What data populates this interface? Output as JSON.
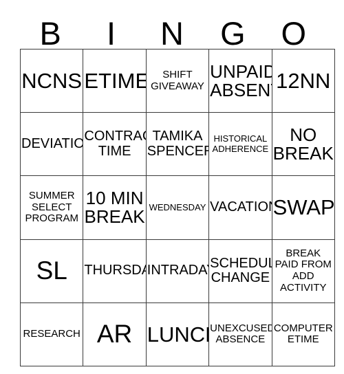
{
  "card": {
    "header_letters": [
      "B",
      "I",
      "N",
      "G",
      "O"
    ],
    "rows": [
      [
        {
          "text": "NCNS",
          "size": "xl"
        },
        {
          "text": "ETIME",
          "size": "xl"
        },
        {
          "text": "SHIFT\nGIVEAWAY",
          "size": "sm"
        },
        {
          "text": "UNPAID\nABSENT",
          "size": "lg"
        },
        {
          "text": "12NN",
          "size": "xl"
        }
      ],
      [
        {
          "text": "DEVIATION",
          "size": "md"
        },
        {
          "text": "CONTRACT\nTIME",
          "size": "md"
        },
        {
          "text": "TAMIKA\nSPENCER",
          "size": "md"
        },
        {
          "text": "HISTORICAL\nADHERENCE",
          "size": "xs"
        },
        {
          "text": "NO\nBREAK",
          "size": "lg"
        }
      ],
      [
        {
          "text": "SUMMER\nSELECT\nPROGRAM",
          "size": "sm"
        },
        {
          "text": "10 MIN\nBREAK",
          "size": "lg"
        },
        {
          "text": "WEDNESDAY",
          "size": "xs"
        },
        {
          "text": "VACATION",
          "size": "md"
        },
        {
          "text": "SWAP",
          "size": "xl"
        }
      ],
      [
        {
          "text": "SL",
          "size": "xxl"
        },
        {
          "text": "THURSDAY",
          "size": "md"
        },
        {
          "text": "INTRADAY",
          "size": "md"
        },
        {
          "text": "SCHEDULE\nCHANGE",
          "size": "md"
        },
        {
          "text": "BREAK\nPAID FROM\nADD\nACTIVITY",
          "size": "sm"
        }
      ],
      [
        {
          "text": "RESEARCH",
          "size": "sm"
        },
        {
          "text": "AR",
          "size": "xxl"
        },
        {
          "text": "LUNCH",
          "size": "xl"
        },
        {
          "text": "UNEXCUSED\nABSENCE",
          "size": "sm"
        },
        {
          "text": "COMPUTER\nETIME",
          "size": "sm"
        }
      ]
    ]
  },
  "colors": {
    "border": "#3a3a3a",
    "text": "#000000",
    "background": "#ffffff"
  }
}
